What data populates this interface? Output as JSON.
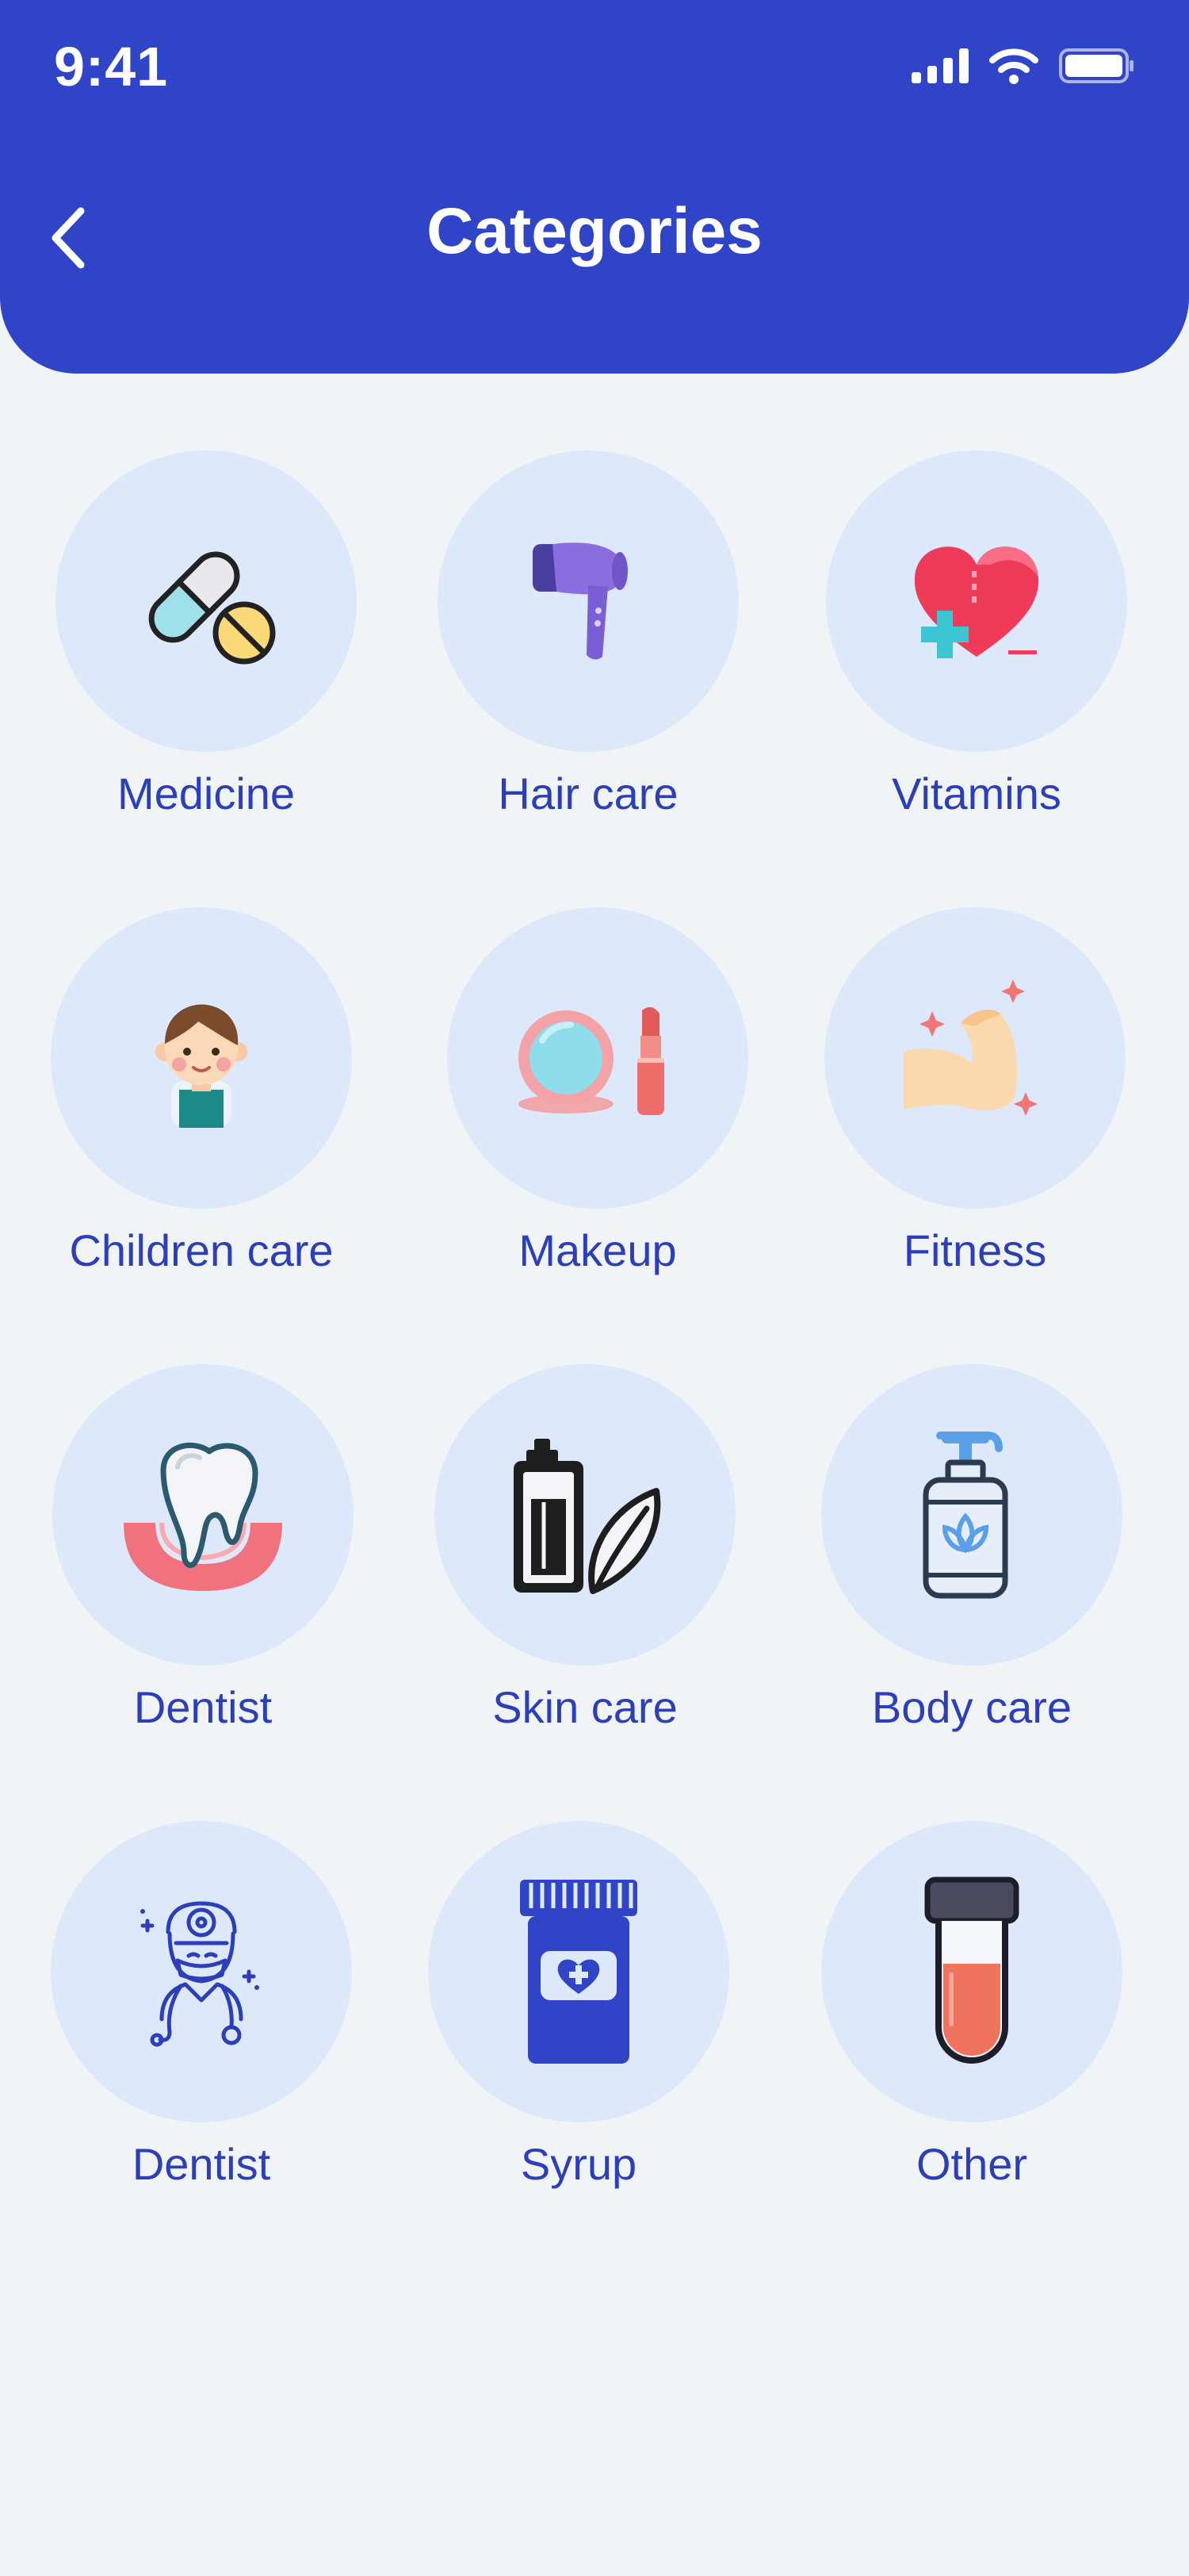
{
  "status_bar": {
    "time": "9:41"
  },
  "header": {
    "title": "Categories"
  },
  "categories": [
    {
      "label": "Medicine",
      "icon": "pills-icon"
    },
    {
      "label": "Hair care",
      "icon": "hair-dryer-icon"
    },
    {
      "label": "Vitamins",
      "icon": "heart-plus-icon"
    },
    {
      "label": "Children care",
      "icon": "child-icon"
    },
    {
      "label": "Makeup",
      "icon": "makeup-icon"
    },
    {
      "label": "Fitness",
      "icon": "muscle-arm-icon"
    },
    {
      "label": "Dentist",
      "icon": "tooth-icon"
    },
    {
      "label": "Skin care",
      "icon": "skin-care-bottle-icon"
    },
    {
      "label": "Body care",
      "icon": "pump-bottle-icon"
    },
    {
      "label": "Dentist",
      "icon": "doctor-icon"
    },
    {
      "label": "Syrup",
      "icon": "syrup-bottle-icon"
    },
    {
      "label": "Other",
      "icon": "test-tube-icon"
    }
  ],
  "colors": {
    "header": "#3044c7",
    "background": "#f1f4f7",
    "circle": "#dde8fb",
    "label": "#2d3fb8"
  }
}
